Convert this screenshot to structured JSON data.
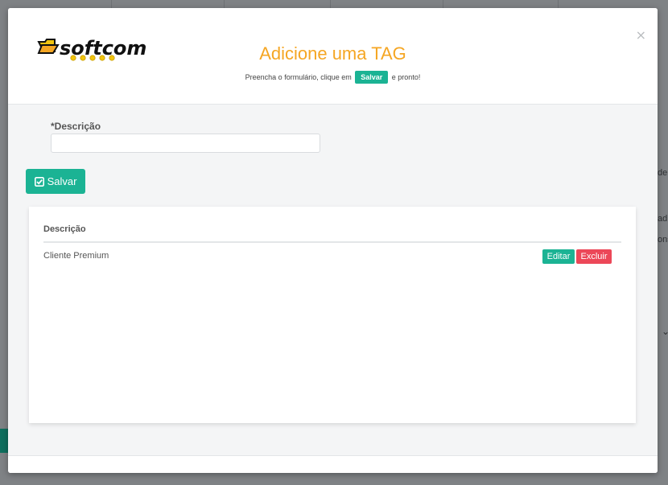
{
  "background": {
    "snippets": [
      "de",
      "ad",
      "ons"
    ]
  },
  "modal": {
    "close_symbol": "×",
    "brand": "softcom",
    "title": "Adicione uma TAG",
    "subtitle_before": "Preencha o formulário, clique em",
    "subtitle_pill": "Salvar",
    "subtitle_after": "e pronto!",
    "form": {
      "label": "*Descrição",
      "value": "",
      "placeholder": ""
    },
    "save_label": "Salvar",
    "table": {
      "header": "Descrição",
      "rows": [
        {
          "descricao": "Cliente Premium",
          "edit_label": "Editar",
          "delete_label": "Excluir"
        }
      ]
    }
  },
  "colors": {
    "accent": "#1bb394",
    "title": "#f5a623",
    "danger": "#ec4758",
    "logo_yellow": "#f1c40f"
  },
  "icons": [
    "close-icon",
    "check-square-icon",
    "softcom-logo"
  ]
}
